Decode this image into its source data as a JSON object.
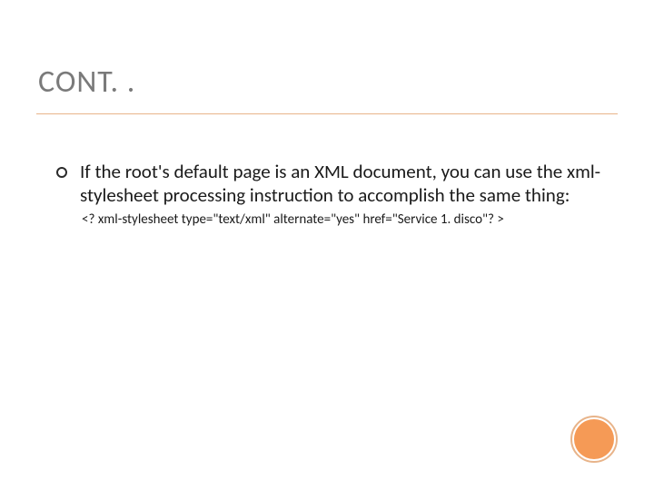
{
  "title": "CONT. .",
  "bullet": {
    "text": "If the root's default page is an XML document, you can use the xml-stylesheet processing instruction to accomplish the same thing:"
  },
  "code": "<? xml-stylesheet type=\"text/xml\" alternate=\"yes\" href=\"Service 1. disco\"? >"
}
